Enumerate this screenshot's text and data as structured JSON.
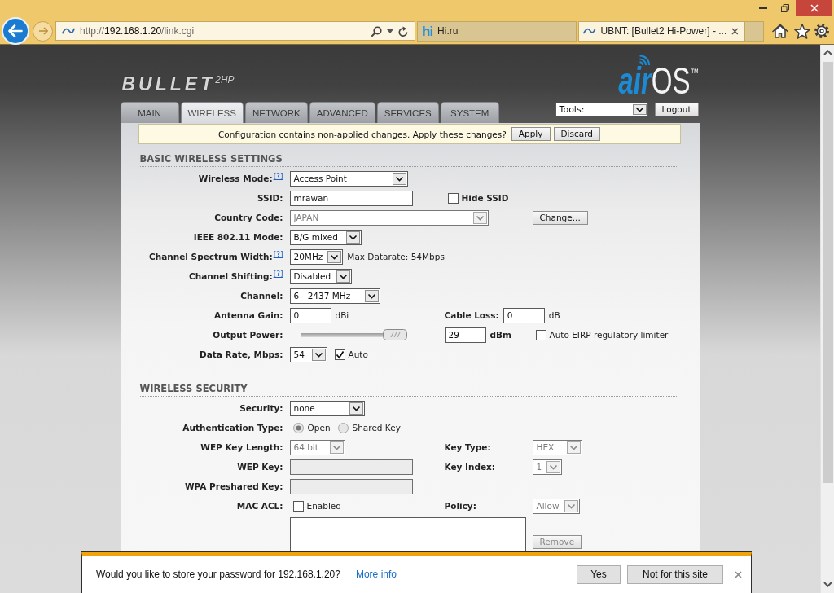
{
  "browser": {
    "address": {
      "scheme": "http://",
      "host": "192.168.1.20",
      "path": "/link.cgi"
    },
    "tabs": [
      {
        "kind": "letters",
        "icon_text": "hi",
        "label": "Hi.ru",
        "selected": false
      },
      {
        "kind": "wave",
        "label": "UBNT: [Bullet2 Hi-Power] - ...",
        "selected": true
      }
    ]
  },
  "header": {
    "product": {
      "name": "BULLET",
      "model": "2HP"
    },
    "brand": {
      "first": "air",
      "second": "OS",
      "mark": "™"
    },
    "tabs": [
      {
        "label": "MAIN",
        "selected": false
      },
      {
        "label": "WIRELESS",
        "selected": true
      },
      {
        "label": "NETWORK",
        "selected": false
      },
      {
        "label": "ADVANCED",
        "selected": false
      },
      {
        "label": "SERVICES",
        "selected": false
      },
      {
        "label": "SYSTEM",
        "selected": false
      }
    ],
    "tools": "Tools:",
    "logout": "Logout"
  },
  "notice": {
    "message": "Configuration contains non-applied changes. Apply these changes?",
    "buttons": [
      "Apply",
      "Discard"
    ]
  },
  "sections": [
    {
      "title": "BASIC WIRELESS SETTINGS",
      "rows": [
        {
          "label": "Wireless Mode:",
          "help": "[?]",
          "main": [
            {
              "kind": "select",
              "value": "Access Point",
              "disabled": false
            }
          ]
        },
        {
          "label": "SSID:",
          "main": [
            {
              "kind": "input",
              "value": "mrawan",
              "disabled": false
            }
          ],
          "side": [
            {
              "kind": "checkbox",
              "checked": false
            },
            {
              "kind": "label",
              "text": "Hide SSID"
            }
          ]
        },
        {
          "label": "Country Code:",
          "main": [
            {
              "kind": "select",
              "value": "JAPAN",
              "disabled": true
            }
          ],
          "far": [
            {
              "kind": "button",
              "label": "Change...",
              "disabled": false
            }
          ]
        },
        {
          "label": "IEEE 802.11 Mode:",
          "main": [
            {
              "kind": "select",
              "value": "B/G mixed",
              "disabled": false
            }
          ]
        },
        {
          "label": "Channel Spectrum Width:",
          "help": "[?]",
          "main": [
            {
              "kind": "select",
              "value": "20MHz",
              "disabled": false
            },
            {
              "kind": "text",
              "text": "Max Datarate: 54Mbps"
            }
          ]
        },
        {
          "label": "Channel Shifting:",
          "help": "[?]",
          "main": [
            {
              "kind": "select",
              "value": "Disabled",
              "disabled": false
            }
          ]
        },
        {
          "label": "Channel:",
          "main": [
            {
              "kind": "select",
              "value": "6 - 2437 MHz",
              "disabled": false
            }
          ]
        },
        {
          "label": "Antenna Gain:",
          "main": [
            {
              "kind": "input",
              "value": "0",
              "disabled": false
            },
            {
              "kind": "text",
              "text": "dBi"
            }
          ],
          "side": [
            {
              "kind": "label",
              "text": "Cable Loss:"
            },
            {
              "kind": "input",
              "value": "0",
              "disabled": false
            },
            {
              "kind": "text",
              "text": "dB"
            }
          ]
        },
        {
          "label": "Output Power:",
          "main": [
            {
              "kind": "slider",
              "level": 1
            }
          ],
          "side": [
            {
              "kind": "input",
              "value": "29",
              "disabled": false
            },
            {
              "kind": "label",
              "text": "dBm"
            }
          ],
          "far": [
            {
              "kind": "checkbox",
              "checked": false
            },
            {
              "kind": "text",
              "text": "Auto EIRP regulatory limiter"
            }
          ]
        },
        {
          "label": "Data Rate, Mbps:",
          "main": [
            {
              "kind": "select",
              "value": "54",
              "disabled": false
            },
            {
              "kind": "checkbox",
              "checked": true
            },
            {
              "kind": "text",
              "text": "Auto"
            }
          ]
        }
      ]
    },
    {
      "title": "WIRELESS SECURITY",
      "rows": [
        {
          "label": "Security:",
          "main": [
            {
              "kind": "select",
              "value": "none",
              "disabled": false
            }
          ]
        },
        {
          "label": "Authentication Type:",
          "main": [
            {
              "kind": "radio",
              "selected": true
            },
            {
              "kind": "text",
              "text": "Open"
            },
            {
              "kind": "radio",
              "selected": false
            },
            {
              "kind": "text",
              "text": "Shared Key"
            }
          ]
        },
        {
          "label": "WEP Key Length:",
          "main": [
            {
              "kind": "select",
              "value": "64 bit",
              "disabled": true
            }
          ],
          "side": [
            {
              "kind": "label",
              "text": "Key Type:"
            }
          ],
          "far": [
            {
              "kind": "select",
              "value": "HEX",
              "disabled": true
            }
          ]
        },
        {
          "label": "WEP Key:",
          "main": [
            {
              "kind": "input",
              "disabled": true
            }
          ],
          "side": [
            {
              "kind": "label",
              "text": "Key Index:"
            }
          ],
          "far": [
            {
              "kind": "select",
              "value": "1",
              "disabled": true
            }
          ]
        },
        {
          "label": "WPA Preshared Key:",
          "main": [
            {
              "kind": "input",
              "disabled": true
            }
          ]
        },
        {
          "label": "MAC ACL:",
          "main": [
            {
              "kind": "checkbox",
              "checked": false
            },
            {
              "kind": "text",
              "text": "Enabled"
            }
          ],
          "side": [
            {
              "kind": "label",
              "text": "Policy:"
            }
          ],
          "far": [
            {
              "kind": "select",
              "value": "Allow",
              "disabled": true
            }
          ]
        },
        {
          "main": [
            {
              "kind": "textarea"
            }
          ],
          "far": [
            {
              "kind": "button",
              "label": "Remove",
              "disabled": true
            }
          ]
        }
      ]
    }
  ],
  "password_prompt": {
    "message": "Would you like to store your password for 192.168.1.20?",
    "link": "More info",
    "buttons": [
      "Yes",
      "Not for this site"
    ]
  }
}
